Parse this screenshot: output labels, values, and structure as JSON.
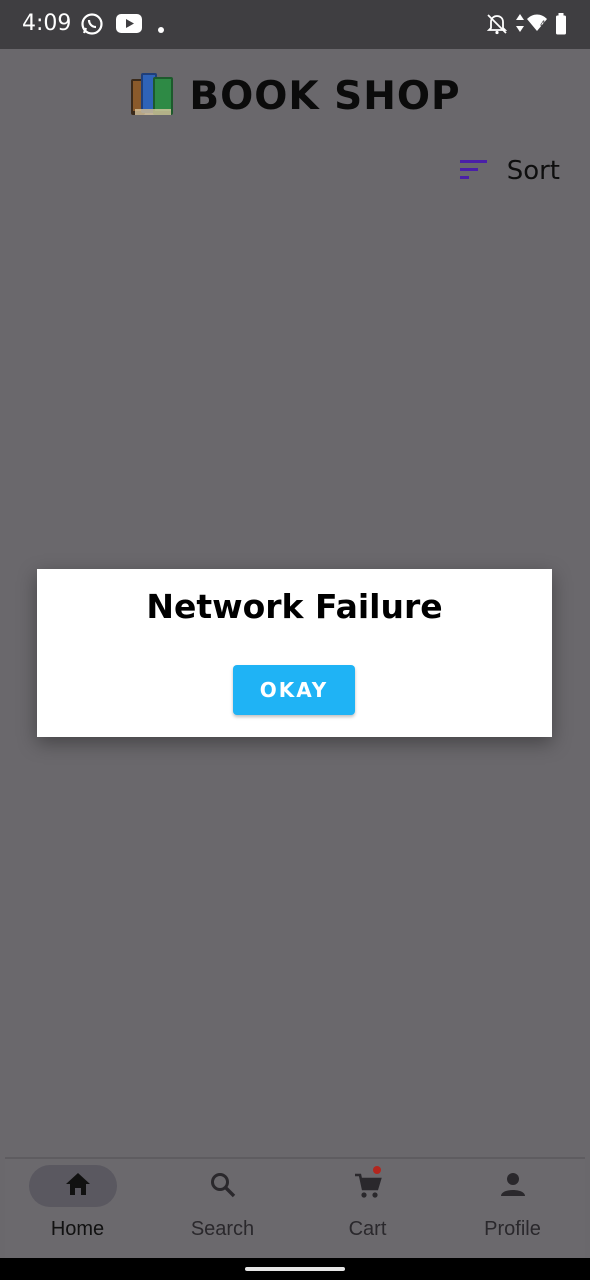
{
  "status_bar": {
    "time": "4:09",
    "icons_left": [
      "whatsapp-icon",
      "youtube-icon",
      "dot-icon"
    ],
    "icons_right": [
      "notifications-off-icon",
      "data-arrows-icon",
      "wifi-icon",
      "battery-icon"
    ],
    "wifi_badge": "4"
  },
  "header": {
    "title": "BOOK SHOP",
    "logo": "books-icon"
  },
  "toolbar": {
    "sort_label": "Sort",
    "sort_icon": "sort-icon",
    "sort_icon_color": "#4a1fa8"
  },
  "dialog": {
    "title": "Network Failure",
    "button_label": "OKAY",
    "button_color": "#1fb3f5"
  },
  "bottom_nav": {
    "items": [
      {
        "label": "Home",
        "icon": "home-icon",
        "active": true
      },
      {
        "label": "Search",
        "icon": "search-icon",
        "active": false
      },
      {
        "label": "Cart",
        "icon": "cart-icon",
        "active": false,
        "badge_dot": true
      },
      {
        "label": "Profile",
        "icon": "person-icon",
        "active": false
      }
    ]
  }
}
